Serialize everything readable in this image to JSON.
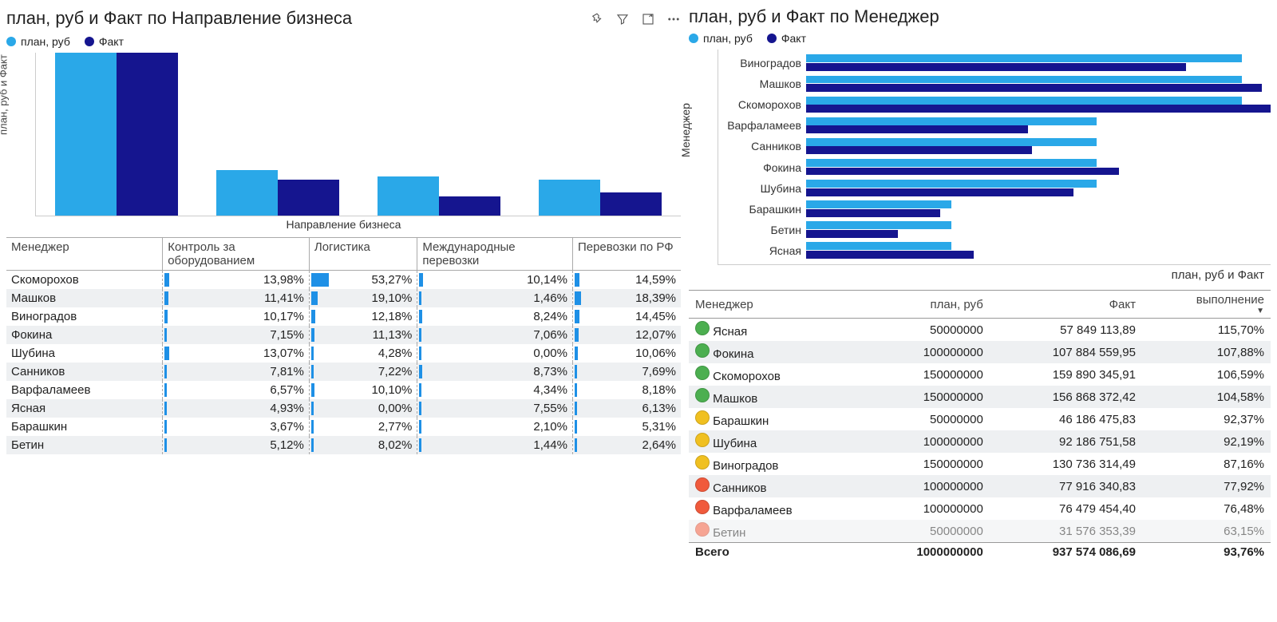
{
  "colors": {
    "plan": "#2aa8e8",
    "fact": "#15158f"
  },
  "left_chart": {
    "title": "план, руб и Факт по Направление бизнеса",
    "legend": {
      "plan": "план, руб",
      "fact": "Факт"
    },
    "ylabel": "план, руб и Факт",
    "xlabel": "Направление бизнеса"
  },
  "chart_data": [
    {
      "type": "bar",
      "orientation": "vertical",
      "title": "план, руб и Факт по Направление бизнеса",
      "xlabel": "Направление бизнеса",
      "ylabel": "план, руб и Факт",
      "categories": [
        "Контроль за оборудованием",
        "Логистика",
        "Международные перевозки",
        "Перевозки по РФ"
      ],
      "series": [
        {
          "name": "план, руб",
          "values": [
            500000000,
            140000000,
            120000000,
            110000000
          ]
        },
        {
          "name": "Факт",
          "values": [
            500000000,
            110000000,
            60000000,
            70000000
          ]
        }
      ],
      "ylim": [
        0,
        500000000
      ]
    },
    {
      "type": "bar",
      "orientation": "horizontal",
      "title": "план, руб и Факт по Менеджер",
      "xlabel": "план, руб и Факт",
      "ylabel": "Менеджер",
      "categories": [
        "Виноградов",
        "Машков",
        "Скоморохов",
        "Варфаламеев",
        "Санников",
        "Фокина",
        "Шубина",
        "Барашкин",
        "Бетин",
        "Ясная"
      ],
      "series": [
        {
          "name": "план, руб",
          "values": [
            150000000,
            150000000,
            150000000,
            100000000,
            100000000,
            100000000,
            100000000,
            50000000,
            50000000,
            50000000
          ]
        },
        {
          "name": "Факт",
          "values": [
            130736314,
            156868372,
            159890346,
            76479454,
            77916341,
            107884560,
            92186752,
            46186476,
            31576354,
            57849114
          ]
        }
      ],
      "xlim": [
        0,
        160000000
      ]
    }
  ],
  "matrix": {
    "headers": [
      "Менеджер",
      "Контроль за оборудованием",
      "Логистика",
      "Международные перевозки",
      "Перевозки по РФ"
    ],
    "max": 53.27,
    "rows": [
      {
        "name": "Скоморохов",
        "v": [
          13.98,
          53.27,
          10.14,
          14.59
        ]
      },
      {
        "name": "Машков",
        "v": [
          11.41,
          19.1,
          1.46,
          18.39
        ]
      },
      {
        "name": "Виноградов",
        "v": [
          10.17,
          12.18,
          8.24,
          14.45
        ]
      },
      {
        "name": "Фокина",
        "v": [
          7.15,
          11.13,
          7.06,
          12.07
        ]
      },
      {
        "name": "Шубина",
        "v": [
          13.07,
          4.28,
          0.0,
          10.06
        ]
      },
      {
        "name": "Санников",
        "v": [
          7.81,
          7.22,
          8.73,
          7.69
        ]
      },
      {
        "name": "Варфаламеев",
        "v": [
          6.57,
          10.1,
          4.34,
          8.18
        ]
      },
      {
        "name": "Ясная",
        "v": [
          4.93,
          0.0,
          7.55,
          6.13
        ]
      },
      {
        "name": "Барашкин",
        "v": [
          3.67,
          2.77,
          2.1,
          5.31
        ]
      },
      {
        "name": "Бетин",
        "v": [
          5.12,
          8.02,
          1.44,
          2.64
        ]
      }
    ]
  },
  "right_chart": {
    "title": "план, руб и Факт по Менеджер",
    "legend": {
      "plan": "план, руб",
      "fact": "Факт"
    },
    "ylabel": "Менеджер",
    "xlabel": "план, руб и Факт"
  },
  "data_table": {
    "headers": [
      "Менеджер",
      "план, руб",
      "Факт",
      "выполнение"
    ],
    "rows": [
      {
        "s": "g",
        "name": "Ясная",
        "plan": "50000000",
        "fact": "57 849 113,89",
        "exec": "115,70%"
      },
      {
        "s": "g",
        "name": "Фокина",
        "plan": "100000000",
        "fact": "107 884 559,95",
        "exec": "107,88%"
      },
      {
        "s": "g",
        "name": "Скоморохов",
        "plan": "150000000",
        "fact": "159 890 345,91",
        "exec": "106,59%"
      },
      {
        "s": "g",
        "name": "Машков",
        "plan": "150000000",
        "fact": "156 868 372,42",
        "exec": "104,58%"
      },
      {
        "s": "y",
        "name": "Барашкин",
        "plan": "50000000",
        "fact": "46 186 475,83",
        "exec": "92,37%"
      },
      {
        "s": "y",
        "name": "Шубина",
        "plan": "100000000",
        "fact": "92 186 751,58",
        "exec": "92,19%"
      },
      {
        "s": "y",
        "name": "Виноградов",
        "plan": "150000000",
        "fact": "130 736 314,49",
        "exec": "87,16%"
      },
      {
        "s": "r",
        "name": "Санников",
        "plan": "100000000",
        "fact": "77 916 340,83",
        "exec": "77,92%"
      },
      {
        "s": "r",
        "name": "Варфаламеев",
        "plan": "100000000",
        "fact": "76 479 454,40",
        "exec": "76,48%"
      },
      {
        "s": "r",
        "name": "Бетин",
        "plan": "50000000",
        "fact": "31 576 353,39",
        "exec": "63,15%"
      }
    ],
    "total": {
      "label": "Всего",
      "plan": "1000000000",
      "fact": "937 574 086,69",
      "exec": "93,76%"
    }
  }
}
